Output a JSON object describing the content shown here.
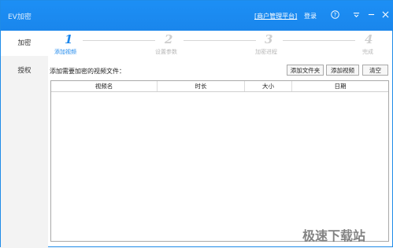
{
  "window": {
    "title": "EV加密",
    "merchant_link": "[商户管理平台]",
    "login": "登录"
  },
  "icons": {
    "help": "help-icon",
    "menu": "menu-icon",
    "minimize": "minimize-icon",
    "close": "close-icon"
  },
  "sidebar": {
    "items": [
      {
        "label": "加密",
        "active": true
      },
      {
        "label": "授权",
        "active": false
      }
    ]
  },
  "steps": [
    {
      "num": "1",
      "label": "添加视频",
      "active": true
    },
    {
      "num": "2",
      "label": "设置参数",
      "active": false
    },
    {
      "num": "3",
      "label": "加密进程",
      "active": false
    },
    {
      "num": "4",
      "label": "完成",
      "active": false
    }
  ],
  "main": {
    "files_label": "添加需要加密的视频文件：",
    "buttons": {
      "add_folder": "添加文件夹",
      "add_video": "添加视频",
      "clear": "清空"
    },
    "table": {
      "columns": [
        "视频名",
        "时长",
        "大小",
        "日期"
      ],
      "rows": []
    }
  },
  "watermark": "极速下载站",
  "colors": {
    "accent": "#1a86ec",
    "titlebar": "#1c8ff5",
    "sidebar_bg": "#f3f3f3"
  }
}
